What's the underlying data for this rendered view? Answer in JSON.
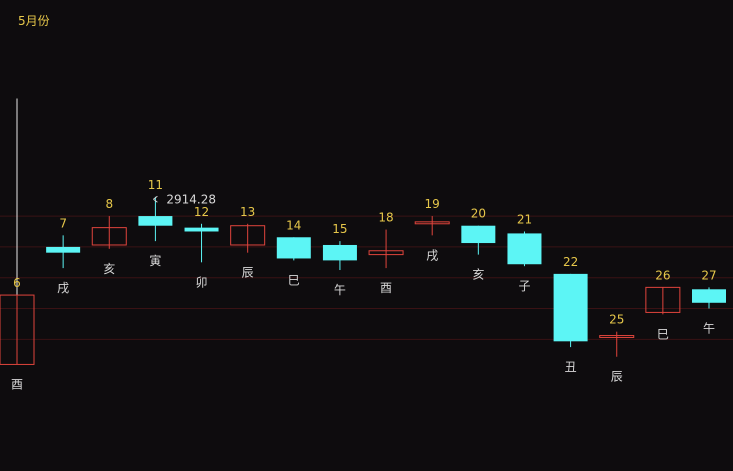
{
  "chart_data": {
    "type": "candlestick",
    "title": "5月份",
    "colors": {
      "up": "#e0443c",
      "down": "#5cf5f5",
      "day_label": "#e6c74a",
      "branch_label": "#d8d8d8",
      "grid": "#3a1214",
      "background": "#0e0c0e"
    },
    "y_range": [
      2780,
      2985
    ],
    "grid_levels": [
      2840,
      2856,
      2872,
      2888,
      2904
    ],
    "candles": [
      {
        "day": "6",
        "branch": "酉",
        "open": 2827,
        "close": 2863,
        "high": 2863,
        "low": 2827,
        "color": "up"
      },
      {
        "day": "7",
        "branch": "戌",
        "open": 2888,
        "close": 2885,
        "high": 2894,
        "low": 2877,
        "color": "down"
      },
      {
        "day": "8",
        "branch": "亥",
        "open": 2889,
        "close": 2898,
        "high": 2904,
        "low": 2887,
        "color": "up"
      },
      {
        "day": "11",
        "branch": "寅",
        "open": 2904,
        "close": 2899,
        "high": 2914,
        "low": 2891,
        "color": "down"
      },
      {
        "day": "12",
        "branch": "卯",
        "open": 2898,
        "close": 2896,
        "high": 2900,
        "low": 2880,
        "color": "down"
      },
      {
        "day": "13",
        "branch": "辰",
        "open": 2889,
        "close": 2899,
        "high": 2900,
        "low": 2885,
        "color": "up"
      },
      {
        "day": "14",
        "branch": "巳",
        "open": 2893,
        "close": 2882,
        "high": 2893,
        "low": 2881,
        "color": "down"
      },
      {
        "day": "15",
        "branch": "午",
        "open": 2889,
        "close": 2881,
        "high": 2891,
        "low": 2876,
        "color": "down"
      },
      {
        "day": "18",
        "branch": "酉",
        "open": 2884,
        "close": 2886,
        "high": 2897,
        "low": 2877,
        "color": "up"
      },
      {
        "day": "19",
        "branch": "戌",
        "open": 2900,
        "close": 2901,
        "high": 2904,
        "low": 2894,
        "color": "up"
      },
      {
        "day": "20",
        "branch": "亥",
        "open": 2899,
        "close": 2890,
        "high": 2899,
        "low": 2884,
        "color": "down"
      },
      {
        "day": "21",
        "branch": "子",
        "open": 2895,
        "close": 2879,
        "high": 2896,
        "low": 2878,
        "color": "down"
      },
      {
        "day": "22",
        "branch": "丑",
        "open": 2874,
        "close": 2839,
        "high": 2874,
        "low": 2836,
        "color": "down"
      },
      {
        "day": "25",
        "branch": "辰",
        "open": 2841,
        "close": 2842,
        "high": 2844,
        "low": 2831,
        "color": "up"
      },
      {
        "day": "26",
        "branch": "巳",
        "open": 2854,
        "close": 2867,
        "high": 2867,
        "low": 2853,
        "color": "up"
      },
      {
        "day": "27",
        "branch": "午",
        "open": 2866,
        "close": 2859,
        "high": 2867,
        "low": 2856,
        "color": "down"
      }
    ],
    "annotation": {
      "text": "2914.28",
      "candle_index": 3,
      "value": 2914.28
    },
    "reference_line": {
      "from": 2827,
      "to": 2965
    }
  }
}
